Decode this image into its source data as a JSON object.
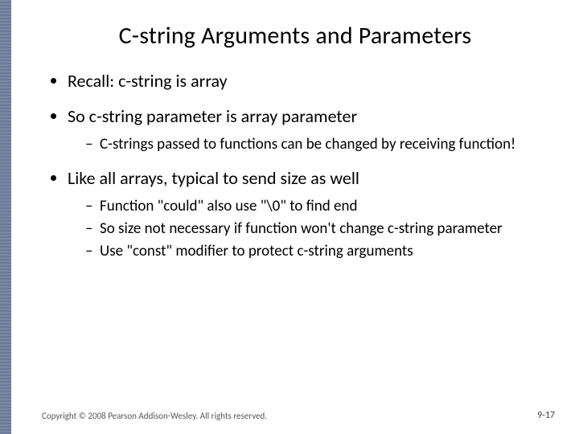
{
  "title": "C-string Arguments and Parameters",
  "bullets": {
    "b1": "Recall: c-string is array",
    "b2": "So c-string parameter is array parameter",
    "b2_sub": {
      "s1": "C-strings passed to functions can be changed by receiving function!"
    },
    "b3": "Like all arrays, typical to send size as well",
    "b3_sub": {
      "s1": "Function \"could\" also use \"\\0\" to find end",
      "s2": "So size not necessary if function won't change c-string parameter",
      "s3": "Use \"const\" modifier to protect c-string arguments"
    }
  },
  "footer": {
    "copyright": "Copyright © 2008 Pearson Addison-Wesley. All rights reserved.",
    "page": "9-17"
  }
}
